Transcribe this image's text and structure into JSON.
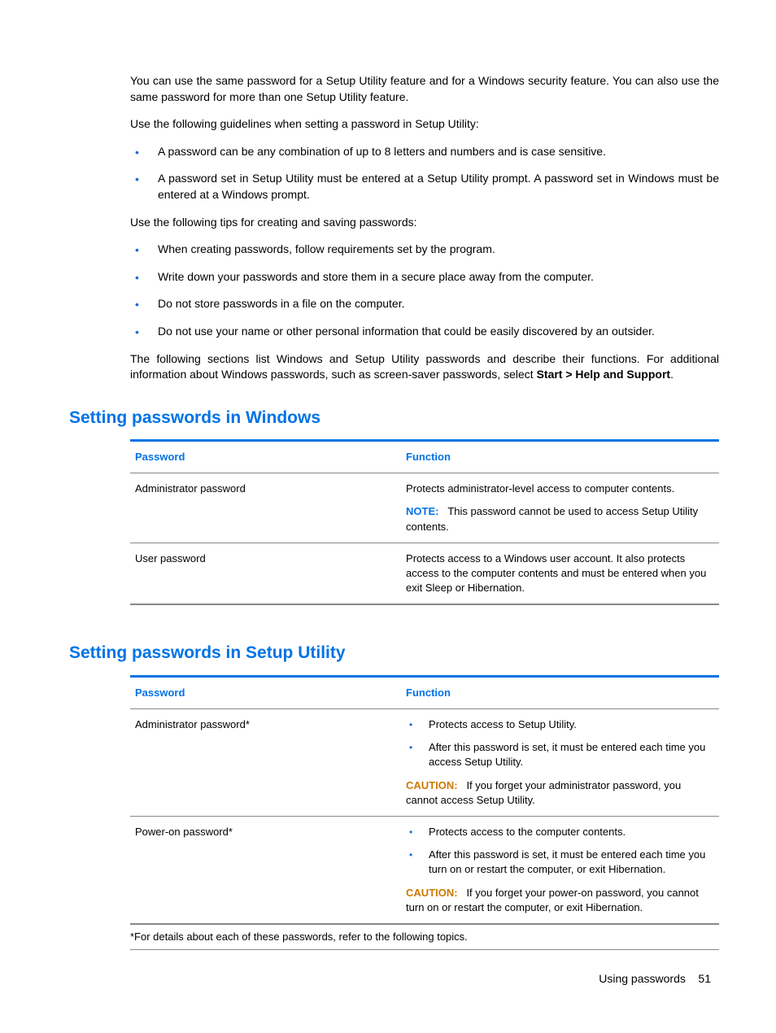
{
  "intro1": "You can use the same password for a Setup Utility feature and for a Windows security feature. You can also use the same password for more than one Setup Utility feature.",
  "intro2": "Use the following guidelines when setting a password in Setup Utility:",
  "guidelines": [
    "A password can be any combination of up to 8 letters and numbers and is case sensitive.",
    "A password set in Setup Utility must be entered at a Setup Utility prompt. A password set in Windows must be entered at a Windows prompt."
  ],
  "tips_intro": "Use the following tips for creating and saving passwords:",
  "tips": [
    "When creating passwords, follow requirements set by the program.",
    "Write down your passwords and store them in a secure place away from the computer.",
    "Do not store passwords in a file on the computer.",
    "Do not use your name or other personal information that could be easily discovered by an outsider."
  ],
  "after_tips_pre": "The following sections list Windows and Setup Utility passwords and describe their functions. For additional information about Windows passwords, such as screen-saver passwords, select ",
  "after_tips_bold": "Start > Help and Support",
  "after_tips_post": ".",
  "section1": {
    "title": "Setting passwords in Windows",
    "head_l": "Password",
    "head_r": "Function",
    "rows": [
      {
        "l": "Administrator password",
        "r_text": "Protects administrator-level access to computer contents.",
        "note_label": "NOTE:",
        "note_text": "This password cannot be used to access Setup Utility contents."
      },
      {
        "l": "User password",
        "r_text": "Protects access to a Windows user account. It also protects access to the computer contents and must be entered when you exit Sleep or Hibernation."
      }
    ]
  },
  "section2": {
    "title": "Setting passwords in Setup Utility",
    "head_l": "Password",
    "head_r": "Function",
    "rows": [
      {
        "l": "Administrator password*",
        "bullets": [
          "Protects access to Setup Utility.",
          "After this password is set, it must be entered each time you access Setup Utility."
        ],
        "caution_label": "CAUTION:",
        "caution_text": "If you forget your administrator password, you cannot access Setup Utility."
      },
      {
        "l": "Power-on password*",
        "bullets": [
          "Protects access to the computer contents.",
          "After this password is set, it must be entered each time you turn on or restart the computer, or exit Hibernation."
        ],
        "caution_label": "CAUTION:",
        "caution_text": "If you forget your power-on password, you cannot turn on or restart the computer, or exit Hibernation."
      }
    ],
    "footnote": "*For details about each of these passwords, refer to the following topics."
  },
  "footer_text": "Using passwords",
  "footer_page": "51"
}
